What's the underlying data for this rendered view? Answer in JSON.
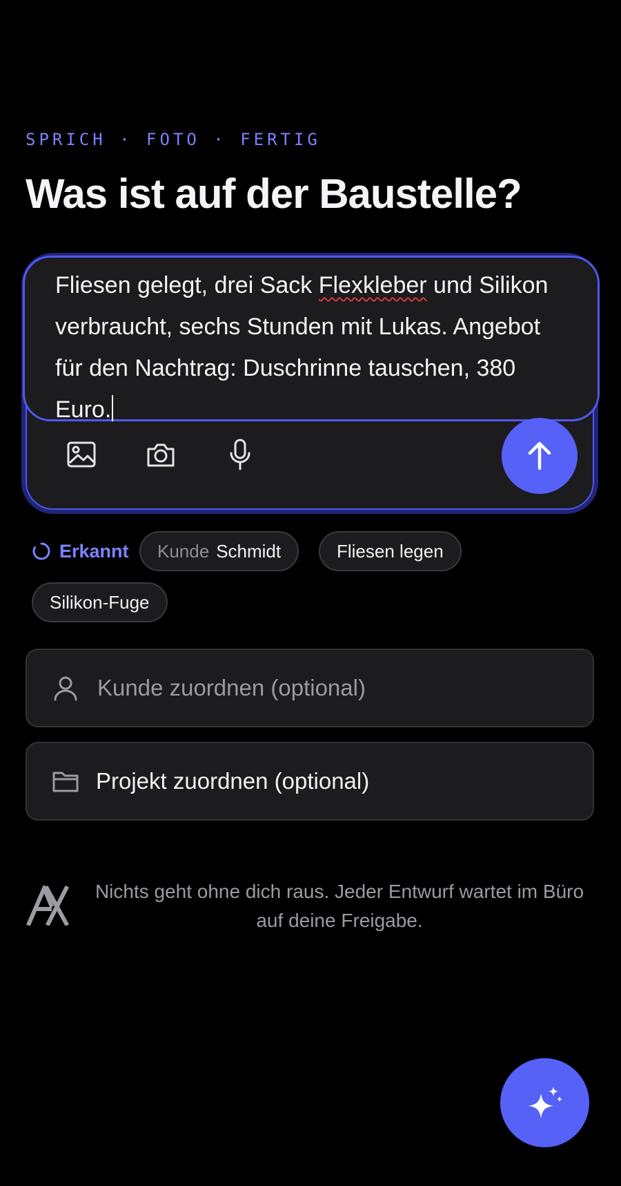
{
  "header": {
    "eyebrow": "SPRICH · FOTO · FERTIG",
    "title": "Was ist auf der Baustelle?"
  },
  "composer": {
    "text_before": "Fliesen gelegt, drei Sack ",
    "text_flagged": "Flexkleber",
    "text_after": " und Silikon verbraucht, sechs Stunden mit Lukas. Angebot für den Nachtrag: Duschrinne tauschen, 380 Euro.",
    "tools": [
      "image-icon",
      "camera-icon",
      "microphone-icon"
    ],
    "send_icon": "arrow-up-icon"
  },
  "detected": {
    "label": "Erkannt",
    "chips": [
      {
        "prefix": "Kunde",
        "value": "Schmidt"
      },
      {
        "prefix": "",
        "value": "Fliesen legen"
      },
      {
        "prefix": "",
        "value": "Silikon-Fuge"
      }
    ]
  },
  "fields": {
    "customer_placeholder": "Kunde zuordnen (optional)",
    "project_value": "Projekt zuordnen (optional)"
  },
  "footer": {
    "note": "Nichts geht ohne dich raus. Jeder Entwurf wartet im Büro auf deine Freigabe."
  },
  "fab_icon": "sparkles-icon",
  "colors": {
    "accent": "#5561f7",
    "accent_text": "#7c82ff",
    "surface": "#1c1c1e",
    "background": "#000000"
  }
}
